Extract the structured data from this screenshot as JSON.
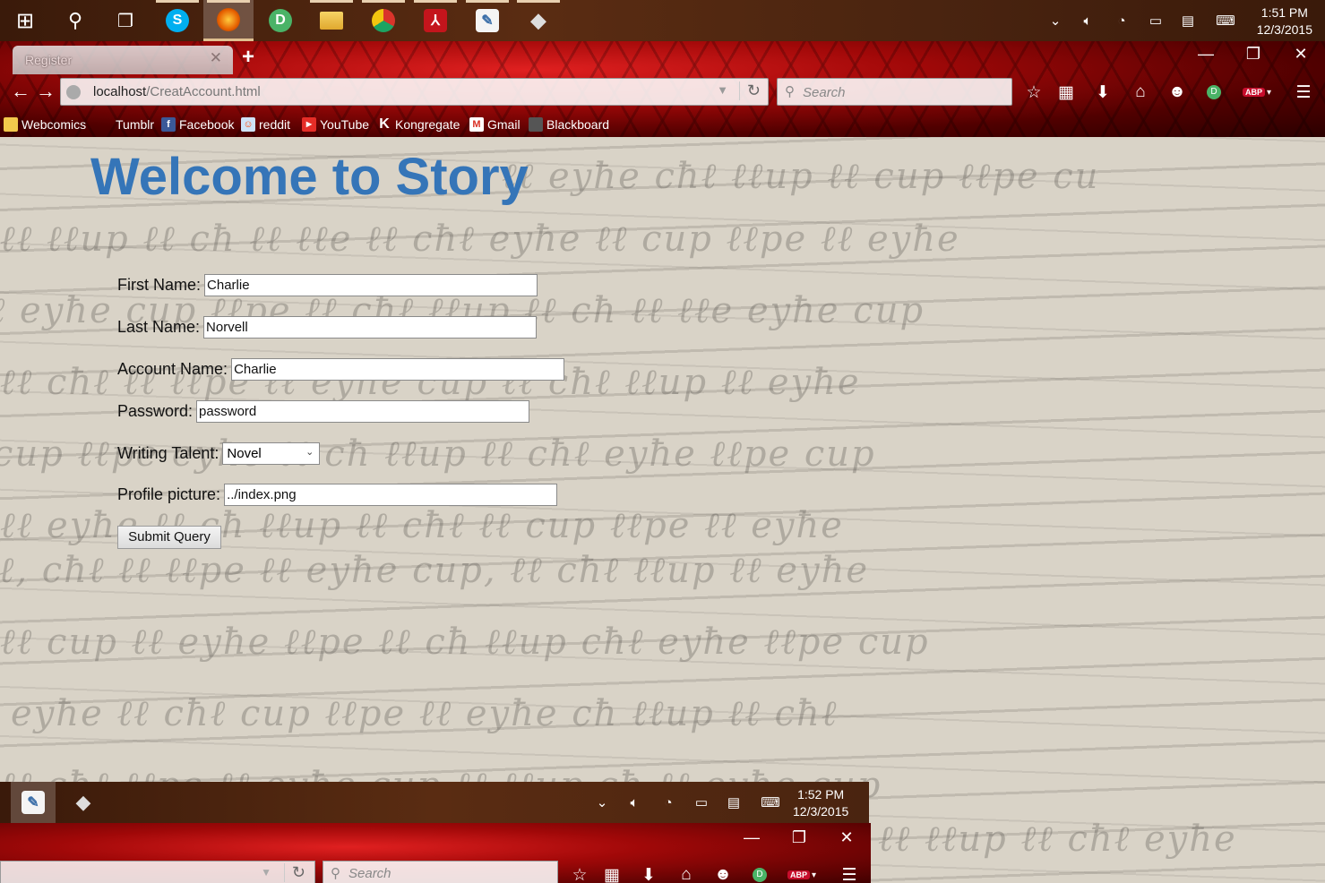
{
  "taskbar": {
    "apps": [
      {
        "name": "start-icon",
        "glyph": "⊞",
        "color": "#ffffff"
      },
      {
        "name": "search-icon",
        "glyph": "⚲",
        "color": "#ffffff"
      },
      {
        "name": "task-view-icon",
        "glyph": "❐",
        "color": "#ffffff"
      },
      {
        "name": "skype-icon",
        "glyph": "S",
        "color": "#00aff0"
      },
      {
        "name": "firefox-icon",
        "glyph": "◉",
        "color": "#e66000"
      },
      {
        "name": "pushbullet-icon",
        "glyph": "D",
        "color": "#4ab367"
      },
      {
        "name": "file-explorer-icon",
        "glyph": "▬",
        "color": "#f2c94c"
      },
      {
        "name": "chrome-icon",
        "glyph": "◐",
        "color": "#d9342b"
      },
      {
        "name": "acrobat-icon",
        "glyph": "A",
        "color": "#c4151c"
      },
      {
        "name": "notepad-icon",
        "glyph": "✎",
        "color": "#7fb3e0"
      },
      {
        "name": "inkscape-icon",
        "glyph": "◆",
        "color": "#444444"
      }
    ],
    "time": "1:51 PM",
    "date": "12/3/2015"
  },
  "browser": {
    "tab_title": "Register",
    "url_host": "localhost",
    "url_path": "/CreatAccount.html",
    "search_placeholder": "Search",
    "bookmarks": [
      "Webcomics",
      "Tumblr",
      "Facebook",
      "reddit",
      "YouTube",
      "Kongregate",
      "Gmail",
      "Blackboard"
    ]
  },
  "page": {
    "heading": "Welcome to Story",
    "first_name_label": "First Name:",
    "first_name_value": "Charlie",
    "last_name_label": "Last Name:",
    "last_name_value": "Norvell",
    "account_name_label": "Account Name:",
    "account_name_value": "Charlie",
    "password_label": "Password:",
    "password_value": "password",
    "talent_label": "Writing Talent:",
    "talent_value": "Novel",
    "picture_label": "Profile picture:",
    "picture_value": "../index.png",
    "submit_label": "Submit Query"
  },
  "taskbar2": {
    "time": "1:52 PM",
    "date": "12/3/2015"
  },
  "colors": {
    "heading": "#3575b8",
    "chrome_red": "#c00000",
    "taskbar_brown": "#4a2410"
  }
}
